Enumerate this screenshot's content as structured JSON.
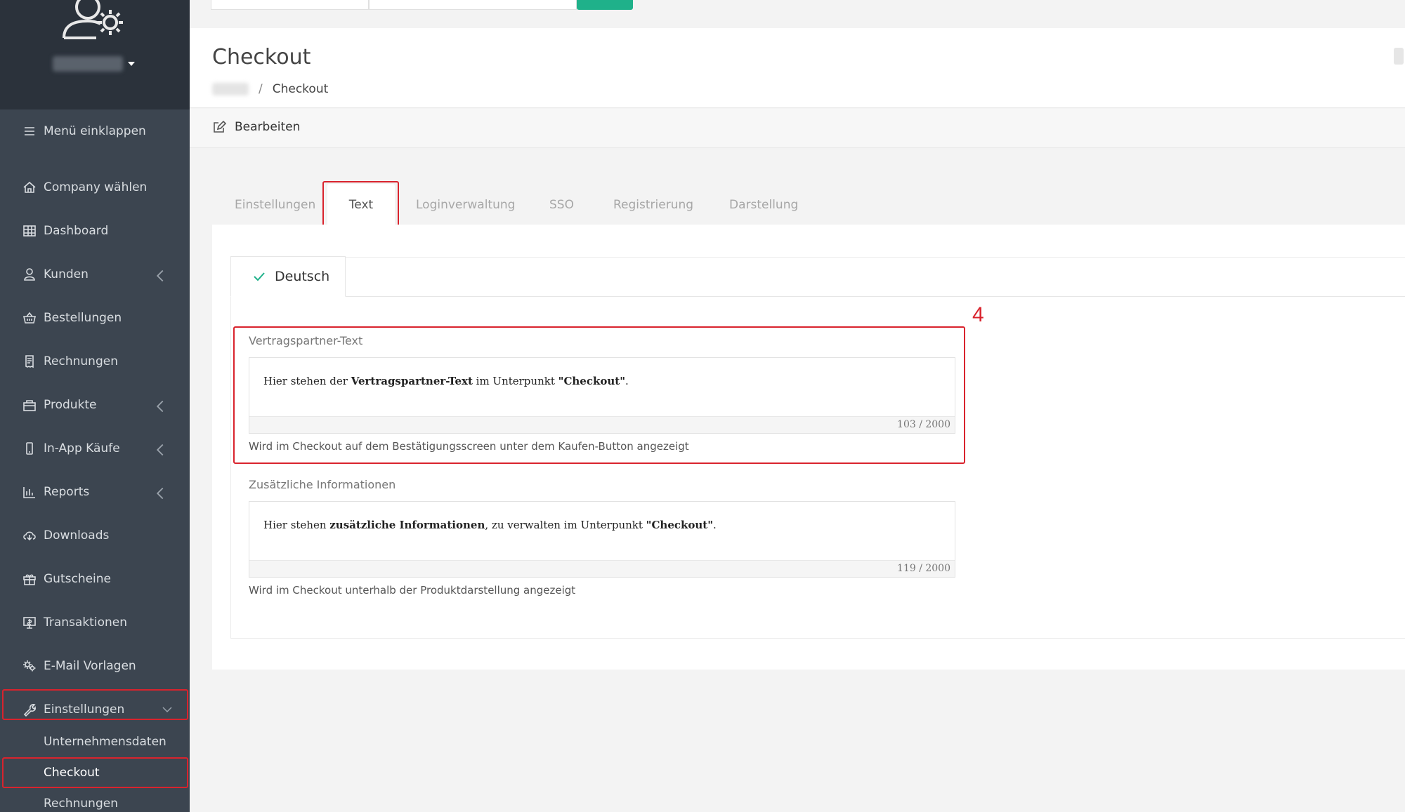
{
  "sidebar": {
    "collapse_label": "Menü einklappen",
    "items": [
      {
        "label": "Company wählen"
      },
      {
        "label": "Dashboard"
      },
      {
        "label": "Kunden"
      },
      {
        "label": "Bestellungen"
      },
      {
        "label": "Rechnungen"
      },
      {
        "label": "Produkte"
      },
      {
        "label": "In-App Käufe"
      },
      {
        "label": "Reports"
      },
      {
        "label": "Downloads"
      },
      {
        "label": "Gutscheine"
      },
      {
        "label": "Transaktionen"
      },
      {
        "label": "E-Mail Vorlagen"
      },
      {
        "label": "Einstellungen"
      }
    ],
    "sub_items": [
      {
        "label": "Unternehmensdaten"
      },
      {
        "label": "Checkout"
      },
      {
        "label": "Rechnungen"
      }
    ]
  },
  "header": {
    "title": "Checkout",
    "breadcrumb_current": "Checkout"
  },
  "toolbar": {
    "edit_label": "Bearbeiten"
  },
  "tabs": [
    {
      "label": "Einstellungen"
    },
    {
      "label": "Text"
    },
    {
      "label": "Loginverwaltung"
    },
    {
      "label": "SSO"
    },
    {
      "label": "Registrierung"
    },
    {
      "label": "Darstellung"
    }
  ],
  "language_tab": {
    "label": "Deutsch"
  },
  "fields": [
    {
      "label": "Vertragspartner-Text",
      "text_before": "Hier stehen der ",
      "text_bold": "Vertragspartner-Text",
      "text_middle": " im Unterpunkt ",
      "text_bold2": "\"Checkout\"",
      "text_after": ".",
      "counter": "103 / 2000",
      "hint": "Wird im Checkout auf dem Bestätigungsscreen unter dem Kaufen-Button angezeigt"
    },
    {
      "label": "Zusätzliche Informationen",
      "text_before": "Hier stehen ",
      "text_bold": "zusätzliche Informationen",
      "text_middle": ", zu verwalten im Unterpunkt ",
      "text_bold2": "\"Checkout\"",
      "text_after": ".",
      "counter": "119 / 2000",
      "hint": "Wird im Checkout unterhalb der Produktdarstellung angezeigt"
    }
  ],
  "annotation": "4",
  "colors": {
    "sidebar_bg": "#3c4550",
    "sidebar_top_bg": "#2b323b",
    "accent_green": "#1fb18a",
    "annotation_red": "#d9232d"
  }
}
